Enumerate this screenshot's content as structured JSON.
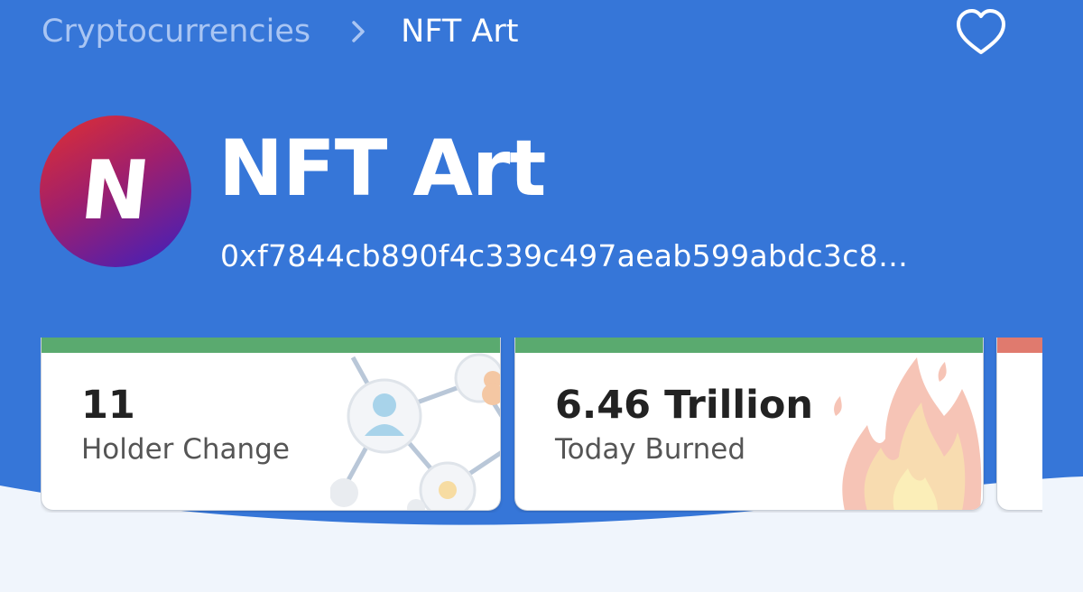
{
  "colors": {
    "header_bg": "#3676d8",
    "page_bg": "#f0f5fc",
    "card_bar_positive": "#5aaa6f",
    "card_bar_negative": "#e07a6e"
  },
  "breadcrumb": {
    "root": "Cryptocurrencies",
    "separator_icon": "chevron-right-icon",
    "current": "NFT Art"
  },
  "favorite": {
    "icon": "heart-outline-icon"
  },
  "token": {
    "avatar_letter": "N",
    "name": "NFT Art",
    "address": "0xf7844cb890f4c339c497aeab599abdc3c8…"
  },
  "cards": [
    {
      "value": "11",
      "label": "Holder Change",
      "status": "positive",
      "icon": "network-icon"
    },
    {
      "value": "6.46 Trillion",
      "label": "Today Burned",
      "status": "positive",
      "icon": "fire-icon"
    },
    {
      "value": "",
      "label": "",
      "status": "negative"
    }
  ]
}
